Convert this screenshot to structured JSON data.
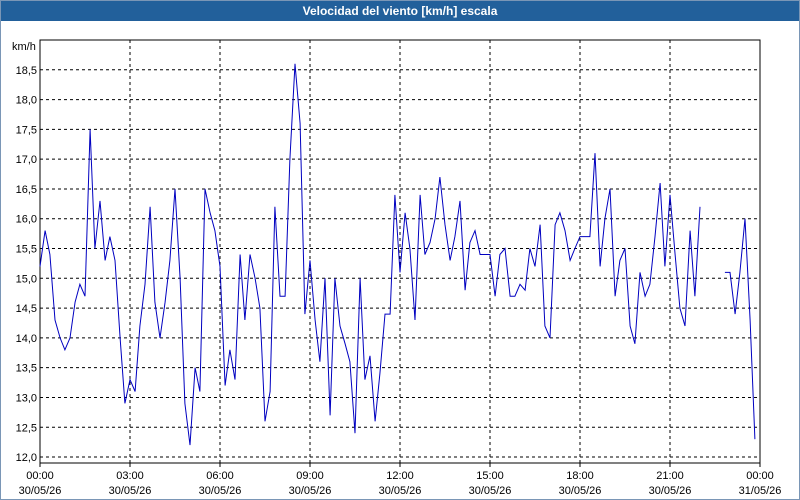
{
  "window": {
    "title": "Velocidad del viento [km/h] escala"
  },
  "chart_data": {
    "type": "line",
    "title": "Velocidad del viento [km/h] escala",
    "ylabel": "km/h",
    "xlabel": "",
    "ylim": [
      11.9,
      19.0
    ],
    "xlim": [
      0,
      24
    ],
    "grid": true,
    "line_color": "#0000c0",
    "y_ticks": [
      "12,0",
      "12,5",
      "13,0",
      "13,5",
      "14,0",
      "14,5",
      "15,0",
      "15,5",
      "16,0",
      "16,5",
      "17,0",
      "17,5",
      "18,0",
      "18,5"
    ],
    "x_ticks": [
      {
        "time": "00:00",
        "date": "30/05/26"
      },
      {
        "time": "03:00",
        "date": "30/05/26"
      },
      {
        "time": "06:00",
        "date": "30/05/26"
      },
      {
        "time": "09:00",
        "date": "30/05/26"
      },
      {
        "time": "12:00",
        "date": "30/05/26"
      },
      {
        "time": "15:00",
        "date": "30/05/26"
      },
      {
        "time": "18:00",
        "date": "30/05/26"
      },
      {
        "time": "21:00",
        "date": "30/05/26"
      },
      {
        "time": "00:00",
        "date": "31/05/26"
      }
    ],
    "series": [
      {
        "segments": [
          [
            [
              0.0,
              15.2
            ],
            [
              0.17,
              15.8
            ],
            [
              0.33,
              15.4
            ],
            [
              0.5,
              14.3
            ],
            [
              0.67,
              14.0
            ],
            [
              0.83,
              13.8
            ],
            [
              1.0,
              14.0
            ],
            [
              1.17,
              14.6
            ],
            [
              1.33,
              14.9
            ],
            [
              1.5,
              14.7
            ],
            [
              1.67,
              17.5
            ],
            [
              1.83,
              15.5
            ],
            [
              2.0,
              16.3
            ],
            [
              2.17,
              15.3
            ],
            [
              2.33,
              15.7
            ],
            [
              2.5,
              15.3
            ],
            [
              2.67,
              14.0
            ],
            [
              2.83,
              12.9
            ],
            [
              3.0,
              13.3
            ],
            [
              3.17,
              13.1
            ],
            [
              3.33,
              14.2
            ],
            [
              3.5,
              14.9
            ],
            [
              3.67,
              16.2
            ],
            [
              3.83,
              14.6
            ],
            [
              4.0,
              14.0
            ],
            [
              4.17,
              14.6
            ],
            [
              4.33,
              15.3
            ],
            [
              4.5,
              16.5
            ],
            [
              4.67,
              15.0
            ],
            [
              4.83,
              12.9
            ],
            [
              5.0,
              12.2
            ],
            [
              5.17,
              13.5
            ],
            [
              5.33,
              13.1
            ],
            [
              5.5,
              16.5
            ],
            [
              5.67,
              16.1
            ],
            [
              5.83,
              15.8
            ],
            [
              6.0,
              15.2
            ],
            [
              6.17,
              13.2
            ],
            [
              6.33,
              13.8
            ],
            [
              6.5,
              13.3
            ],
            [
              6.67,
              15.4
            ],
            [
              6.83,
              14.3
            ],
            [
              7.0,
              15.4
            ],
            [
              7.17,
              15.0
            ],
            [
              7.33,
              14.5
            ],
            [
              7.5,
              12.6
            ],
            [
              7.67,
              13.1
            ],
            [
              7.83,
              16.2
            ],
            [
              8.0,
              14.7
            ],
            [
              8.17,
              14.7
            ],
            [
              8.33,
              17.0
            ],
            [
              8.5,
              18.6
            ],
            [
              8.67,
              17.6
            ],
            [
              8.83,
              14.4
            ],
            [
              9.0,
              15.3
            ],
            [
              9.17,
              14.3
            ],
            [
              9.33,
              13.6
            ],
            [
              9.5,
              15.0
            ],
            [
              9.67,
              12.7
            ],
            [
              9.83,
              15.0
            ],
            [
              10.0,
              14.2
            ],
            [
              10.17,
              13.9
            ],
            [
              10.33,
              13.6
            ],
            [
              10.5,
              12.4
            ],
            [
              10.67,
              15.0
            ],
            [
              10.83,
              13.3
            ],
            [
              11.0,
              13.7
            ],
            [
              11.17,
              12.6
            ],
            [
              11.33,
              13.4
            ],
            [
              11.5,
              14.4
            ],
            [
              11.67,
              14.4
            ],
            [
              11.83,
              16.4
            ],
            [
              12.0,
              15.1
            ],
            [
              12.17,
              16.1
            ],
            [
              12.33,
              15.5
            ],
            [
              12.5,
              14.3
            ],
            [
              12.67,
              16.4
            ],
            [
              12.83,
              15.4
            ],
            [
              13.0,
              15.6
            ],
            [
              13.17,
              16.0
            ],
            [
              13.33,
              16.7
            ],
            [
              13.5,
              15.9
            ],
            [
              13.67,
              15.3
            ],
            [
              13.83,
              15.7
            ],
            [
              14.0,
              16.3
            ],
            [
              14.17,
              14.8
            ],
            [
              14.33,
              15.6
            ],
            [
              14.5,
              15.8
            ],
            [
              14.67,
              15.4
            ],
            [
              14.83,
              15.4
            ],
            [
              15.0,
              15.4
            ],
            [
              15.17,
              14.7
            ],
            [
              15.33,
              15.4
            ],
            [
              15.5,
              15.5
            ],
            [
              15.67,
              14.7
            ],
            [
              15.83,
              14.7
            ],
            [
              16.0,
              14.9
            ],
            [
              16.17,
              14.8
            ],
            [
              16.33,
              15.5
            ],
            [
              16.5,
              15.2
            ],
            [
              16.67,
              15.9
            ],
            [
              16.83,
              14.2
            ],
            [
              17.0,
              14.0
            ],
            [
              17.17,
              15.9
            ],
            [
              17.33,
              16.1
            ],
            [
              17.5,
              15.8
            ],
            [
              17.67,
              15.3
            ],
            [
              17.83,
              15.5
            ],
            [
              18.0,
              15.7
            ],
            [
              18.17,
              15.7
            ],
            [
              18.33,
              15.7
            ],
            [
              18.5,
              17.1
            ],
            [
              18.67,
              15.2
            ],
            [
              18.83,
              16.0
            ],
            [
              19.0,
              16.5
            ],
            [
              19.17,
              14.7
            ],
            [
              19.33,
              15.3
            ],
            [
              19.5,
              15.5
            ],
            [
              19.67,
              14.2
            ],
            [
              19.83,
              13.9
            ],
            [
              20.0,
              15.1
            ],
            [
              20.17,
              14.7
            ],
            [
              20.33,
              14.9
            ],
            [
              20.5,
              15.7
            ],
            [
              20.67,
              16.6
            ],
            [
              20.83,
              15.2
            ],
            [
              21.0,
              16.4
            ],
            [
              21.17,
              15.4
            ],
            [
              21.33,
              14.5
            ],
            [
              21.5,
              14.2
            ],
            [
              21.67,
              15.8
            ],
            [
              21.83,
              14.7
            ],
            [
              22.0,
              16.2
            ]
          ],
          [
            [
              22.83,
              15.1
            ],
            [
              23.0,
              15.1
            ],
            [
              23.17,
              14.4
            ],
            [
              23.33,
              15.1
            ],
            [
              23.5,
              16.0
            ],
            [
              23.67,
              14.3
            ],
            [
              23.83,
              12.3
            ]
          ]
        ]
      }
    ]
  }
}
